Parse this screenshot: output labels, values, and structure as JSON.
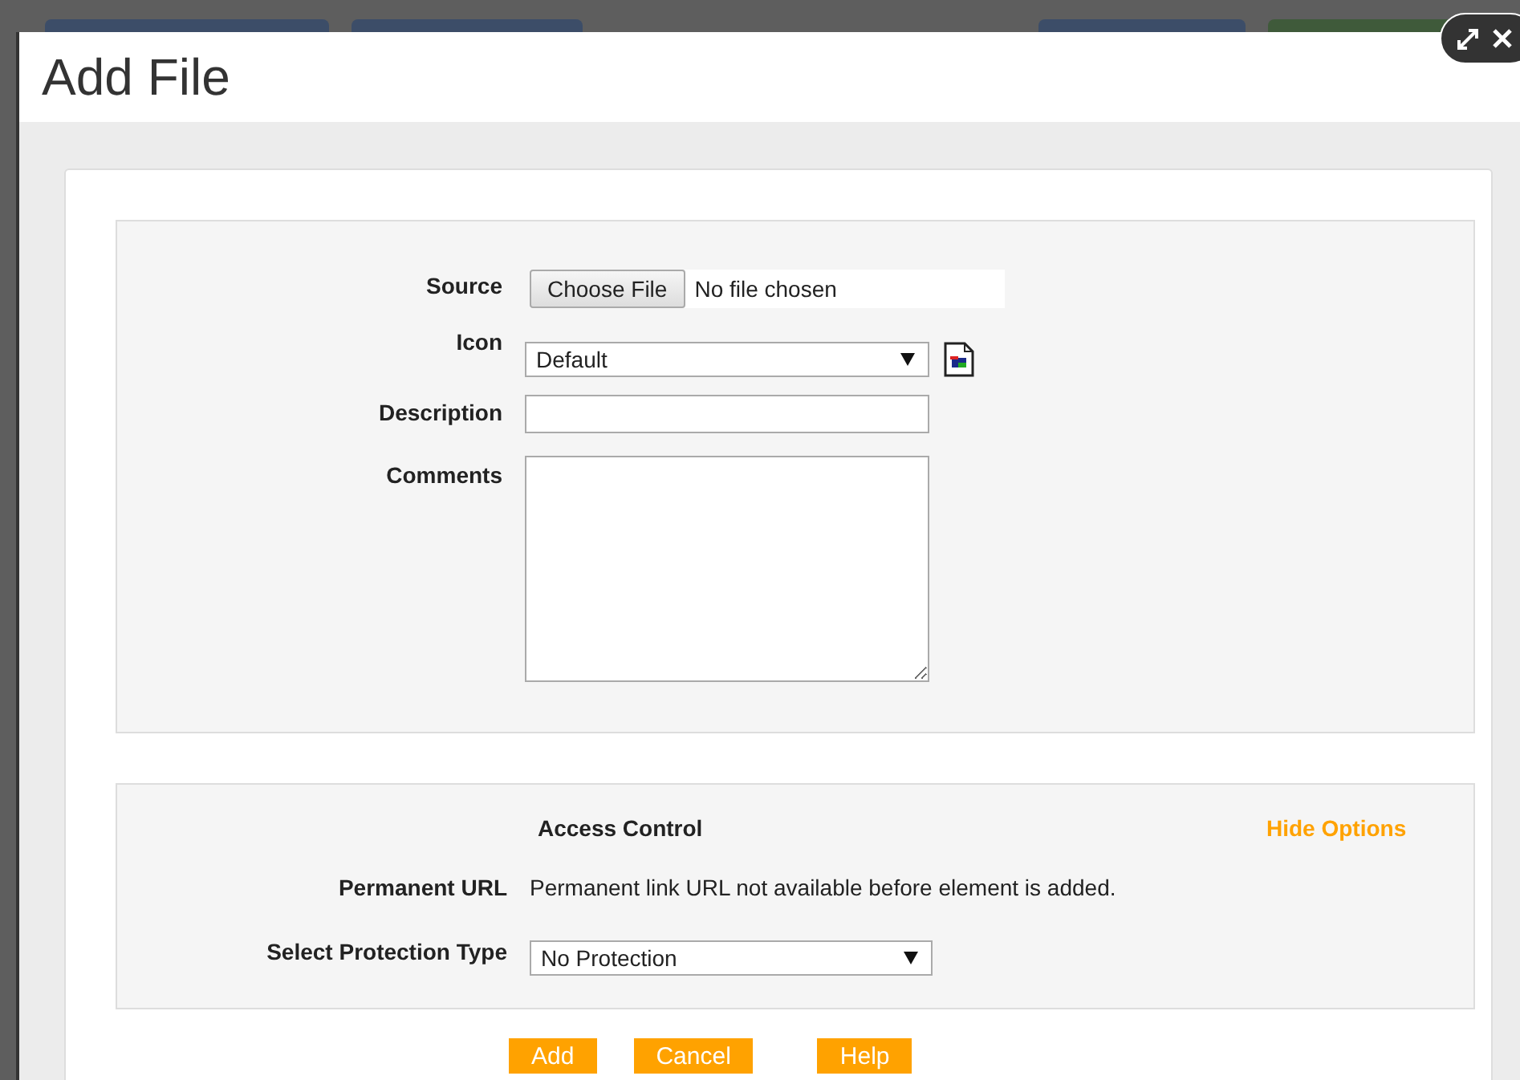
{
  "window": {
    "title": "Add File"
  },
  "form": {
    "fields": [
      {
        "kind": "file",
        "label": "Source",
        "button": "Choose File",
        "value": "No file chosen"
      },
      {
        "kind": "select",
        "label": "Icon",
        "value": "Default"
      },
      {
        "kind": "text",
        "label": "Description"
      },
      {
        "kind": "textarea",
        "label": "Comments"
      }
    ]
  },
  "access_control": {
    "title": "Access Control",
    "toggle": "Hide Options",
    "rows": [
      {
        "kind": "text",
        "label": "Permanent URL",
        "value": "Permanent link URL not available before element is added."
      },
      {
        "kind": "select",
        "label": "Select Protection Type",
        "value": "No Protection"
      }
    ]
  },
  "buttons": [
    "Add",
    "Cancel",
    "Help"
  ]
}
